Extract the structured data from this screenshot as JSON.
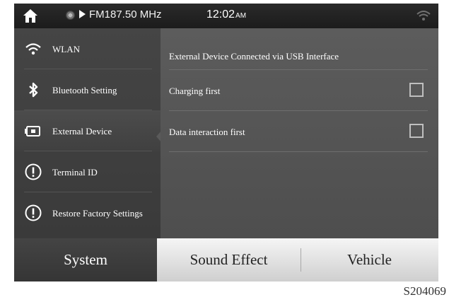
{
  "status_bar": {
    "radio_text": "FM187.50 MHz",
    "time": "12:02",
    "ampm": "AM"
  },
  "sidebar": {
    "items": [
      {
        "label": "WLAN",
        "icon": "wifi-icon"
      },
      {
        "label": "Bluetooth Setting",
        "icon": "bluetooth-icon"
      },
      {
        "label": "External Device",
        "icon": "external-device-icon",
        "active": true
      },
      {
        "label": "Terminal ID",
        "icon": "info-icon"
      },
      {
        "label": "Restore Factory Settings",
        "icon": "info-icon"
      }
    ]
  },
  "content": {
    "title": "External Device Connected via USB Interface",
    "options": [
      {
        "label": "Charging first",
        "checked": false
      },
      {
        "label": "Data interaction first",
        "checked": false
      }
    ]
  },
  "tabs": {
    "items": [
      {
        "label": "System",
        "active": true
      },
      {
        "label": "Sound Effect",
        "active": false
      },
      {
        "label": "Vehicle",
        "active": false
      }
    ]
  },
  "figure_id": "S204069"
}
